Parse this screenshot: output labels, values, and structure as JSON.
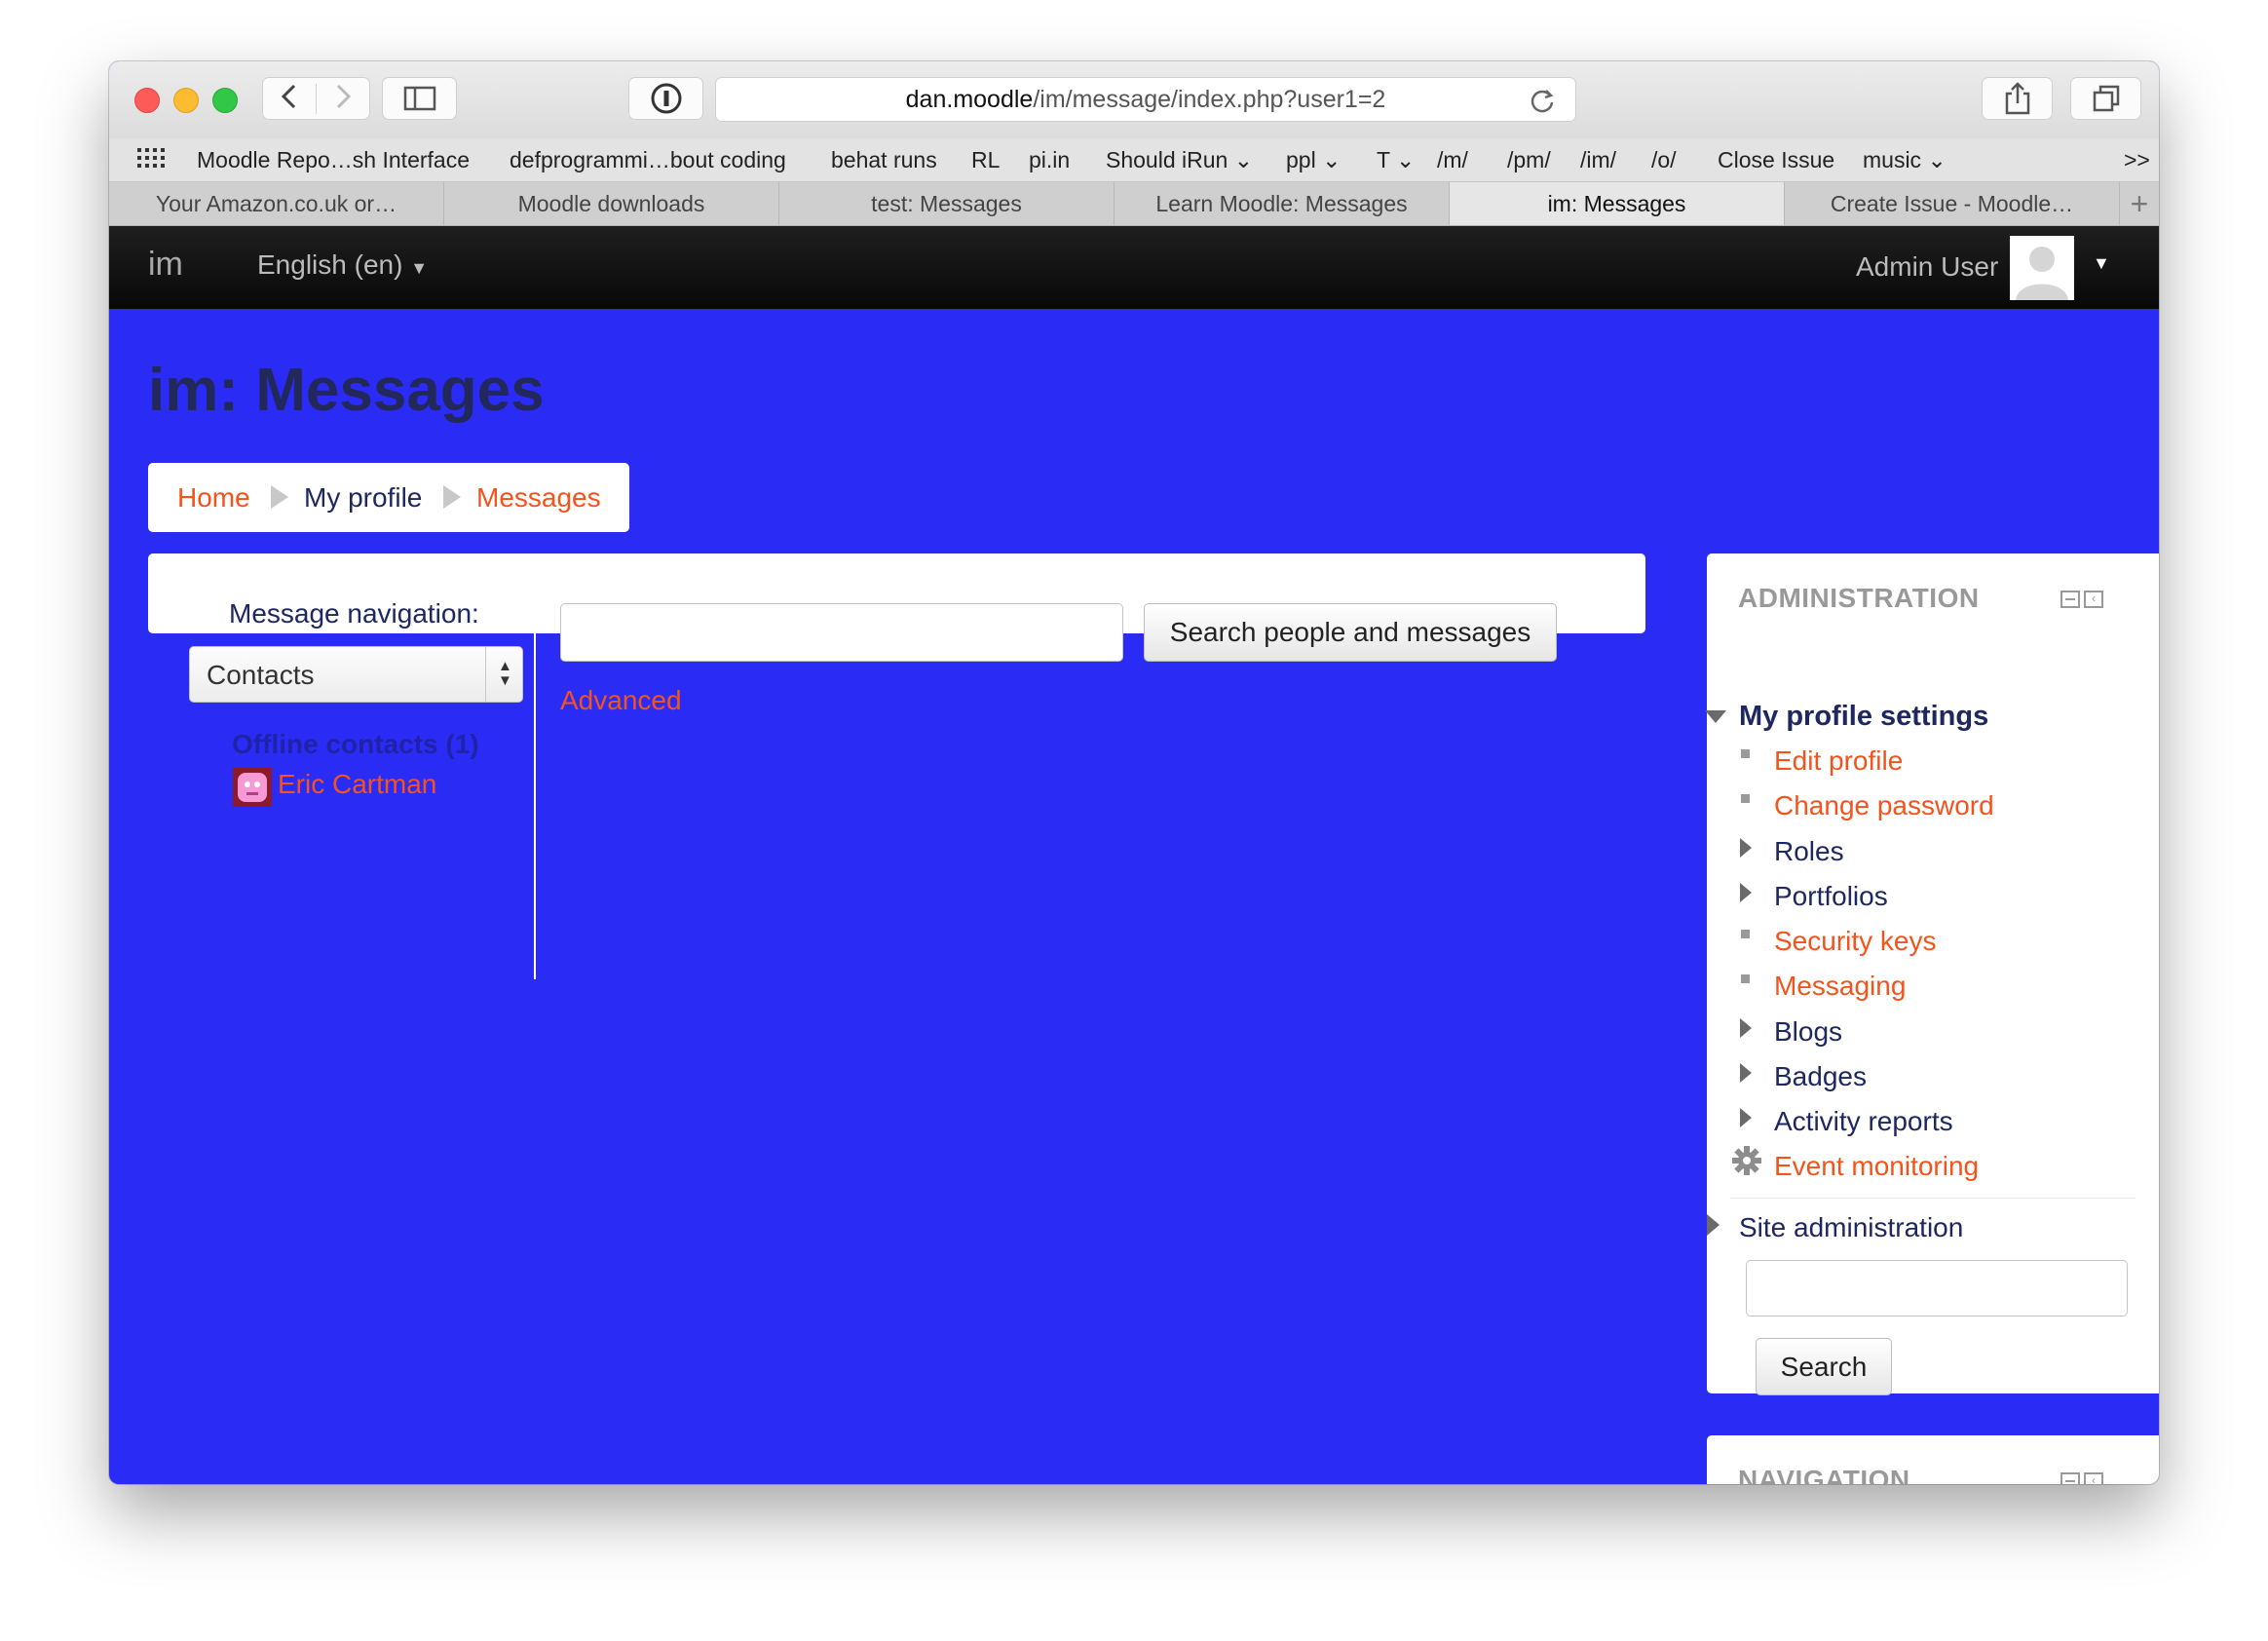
{
  "browser": {
    "url_host": "dan.moodle",
    "url_path": "/im/message/index.php?user1=2",
    "bookmarks": [
      "Moodle Repo…sh Interface",
      "defprogrammi…bout coding",
      "behat runs",
      "RL",
      "pi.in",
      "Should iRun",
      "ppl",
      "T",
      "/m/",
      "/pm/",
      "/im/",
      "/o/",
      "Close Issue",
      "music"
    ],
    "overflow": ">>",
    "tabs": [
      "Your Amazon.co.uk or…",
      "Moodle downloads",
      "test: Messages",
      "Learn Moodle: Messages",
      "im: Messages",
      "Create Issue - Moodle…"
    ],
    "active_tab_index": 4,
    "new_tab": "+"
  },
  "navbar": {
    "brand": "im",
    "language": "English (en)",
    "user": "Admin User"
  },
  "page": {
    "title": "im: Messages",
    "breadcrumb": [
      "Home",
      "My profile",
      "Messages"
    ]
  },
  "messages": {
    "nav_label": "Message navigation:",
    "select_value": "Contacts",
    "search_input_value": "",
    "search_button": "Search people and messages",
    "advanced_link": "Advanced",
    "offline_contacts": "Offline contacts (1)",
    "contact_name": "Eric Cartman"
  },
  "administration": {
    "title": "ADMINISTRATION",
    "section": "My profile settings",
    "items": [
      "Edit profile",
      "Change password",
      "Roles",
      "Portfolios",
      "Security keys",
      "Messaging",
      "Blogs",
      "Badges",
      "Activity reports",
      "Event monitoring"
    ],
    "site_admin": "Site administration",
    "search_input_value": "",
    "search_button": "Search"
  },
  "navigation": {
    "title": "NAVIGATION"
  },
  "colors": {
    "page_bg": "#2a2cf5",
    "link": "#f4531c",
    "text_navy": "#1d2760"
  }
}
